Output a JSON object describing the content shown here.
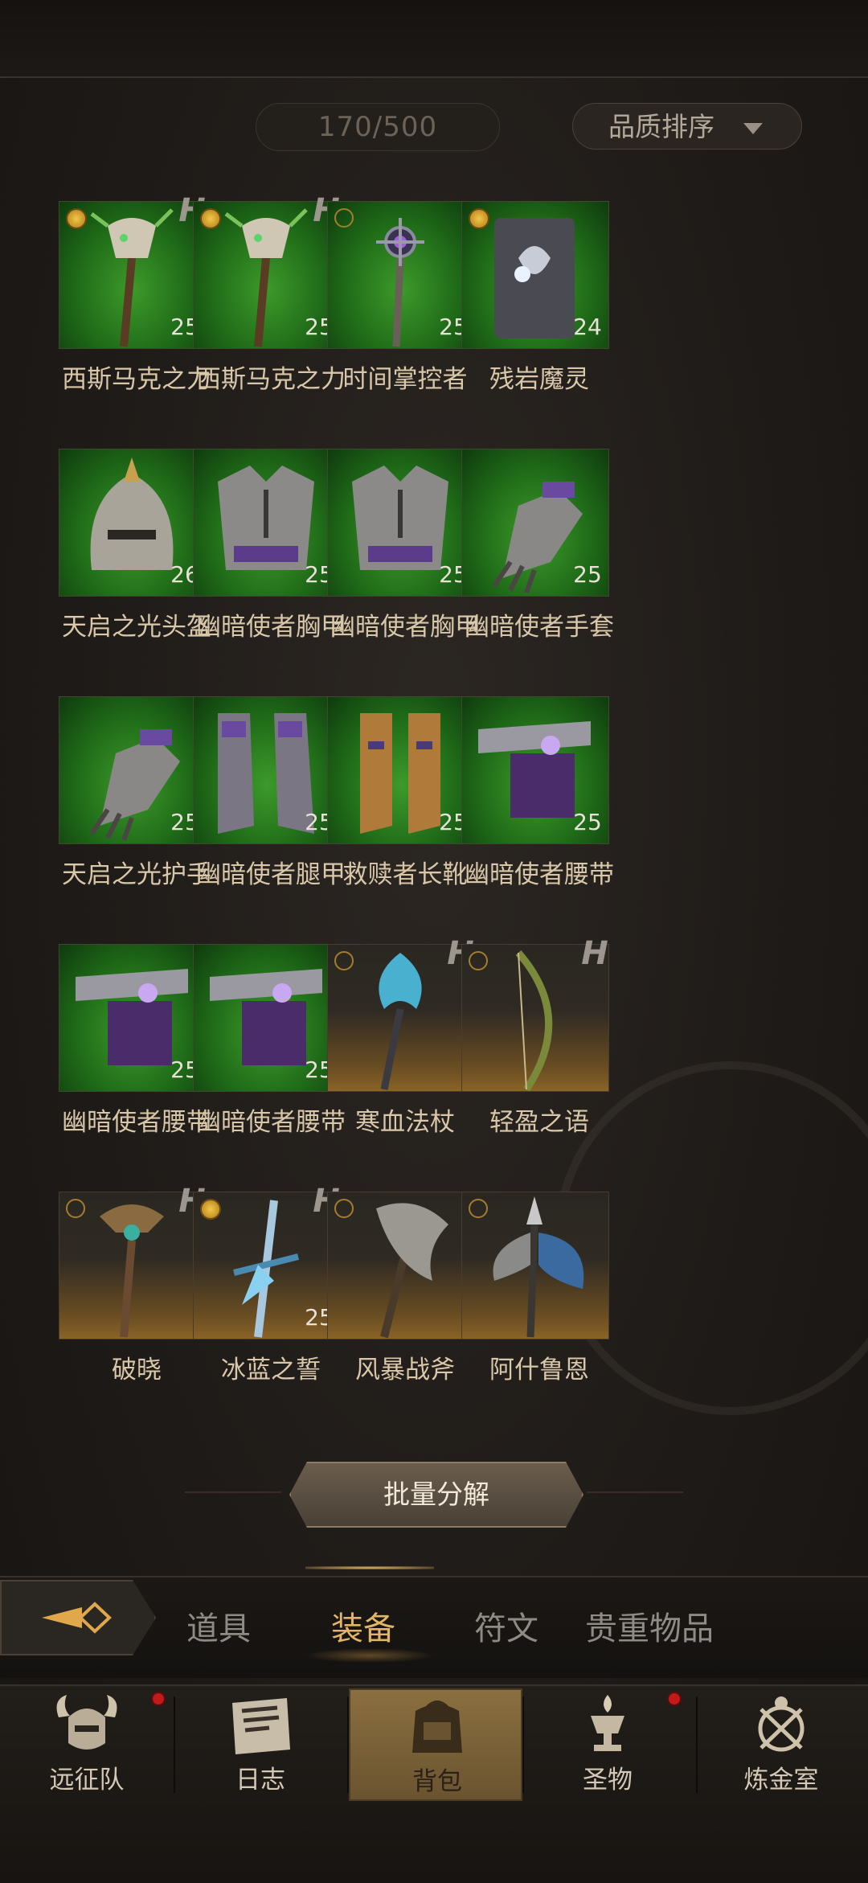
{
  "inventory": {
    "count": "170/500",
    "sort_label": "品质排序",
    "items": [
      {
        "name": "西斯马克之力",
        "level": "25",
        "bg": "green",
        "badge": "gold",
        "h": true,
        "icon": "staff-skull-icon"
      },
      {
        "name": "西斯马克之力",
        "level": "25",
        "bg": "green",
        "badge": "gold",
        "h": true,
        "icon": "staff-skull-icon"
      },
      {
        "name": "时间掌控者",
        "level": "25",
        "bg": "green",
        "badge": "ring",
        "h": false,
        "icon": "scepter-icon"
      },
      {
        "name": "残岩魔灵",
        "level": "24",
        "bg": "green",
        "badge": "gold",
        "h": false,
        "icon": "tome-icon"
      },
      {
        "name": "天启之光头盔",
        "level": "26",
        "bg": "green",
        "badge": "",
        "h": false,
        "icon": "helmet-icon"
      },
      {
        "name": "幽暗使者胸甲",
        "level": "25",
        "bg": "green",
        "badge": "",
        "h": false,
        "icon": "chest-armor-icon"
      },
      {
        "name": "幽暗使者胸甲",
        "level": "25",
        "bg": "green",
        "badge": "",
        "h": false,
        "icon": "chest-armor-icon"
      },
      {
        "name": "幽暗使者手套",
        "level": "25",
        "bg": "green",
        "badge": "",
        "h": false,
        "icon": "gauntlet-icon"
      },
      {
        "name": "天启之光护手",
        "level": "25",
        "bg": "green",
        "badge": "",
        "h": false,
        "icon": "gauntlet-icon"
      },
      {
        "name": "幽暗使者腿甲",
        "level": "25",
        "bg": "green",
        "badge": "",
        "h": false,
        "icon": "leg-armor-icon"
      },
      {
        "name": "救赎者长靴",
        "level": "25",
        "bg": "green",
        "badge": "",
        "h": false,
        "icon": "boots-icon"
      },
      {
        "name": "幽暗使者腰带",
        "level": "25",
        "bg": "green",
        "badge": "",
        "h": false,
        "icon": "belt-icon"
      },
      {
        "name": "幽暗使者腰带",
        "level": "25",
        "bg": "green",
        "badge": "",
        "h": false,
        "icon": "belt-icon"
      },
      {
        "name": "幽暗使者腰带",
        "level": "25",
        "bg": "green",
        "badge": "",
        "h": false,
        "icon": "belt-icon"
      },
      {
        "name": "寒血法杖",
        "level": "",
        "bg": "brown",
        "badge": "ring",
        "h": true,
        "icon": "ice-staff-icon"
      },
      {
        "name": "轻盈之语",
        "level": "",
        "bg": "brown",
        "badge": "ring",
        "h": true,
        "icon": "bow-icon"
      },
      {
        "name": "破晓",
        "level": "",
        "bg": "brown",
        "badge": "ring",
        "h": true,
        "icon": "staff-icon"
      },
      {
        "name": "冰蓝之誓",
        "level": "25",
        "bg": "brown",
        "badge": "gold",
        "h": true,
        "icon": "ice-sword-icon"
      },
      {
        "name": "风暴战斧",
        "level": "",
        "bg": "brown",
        "badge": "ring",
        "h": false,
        "icon": "axe-icon"
      },
      {
        "name": "阿什鲁恩",
        "level": "",
        "bg": "brown",
        "badge": "ring",
        "h": false,
        "icon": "halberd-icon"
      }
    ]
  },
  "bulk_button": "批量分解",
  "tabs": [
    {
      "label": "道具",
      "active": false
    },
    {
      "label": "装备",
      "active": true
    },
    {
      "label": "符文",
      "active": false
    },
    {
      "label": "贵重物品",
      "active": false
    }
  ],
  "nav": [
    {
      "label": "远征队",
      "icon": "horned-helmet-icon",
      "active": false,
      "dot": true
    },
    {
      "label": "日志",
      "icon": "scroll-icon",
      "active": false,
      "dot": false
    },
    {
      "label": "背包",
      "icon": "backpack-icon",
      "active": true,
      "dot": false
    },
    {
      "label": "圣物",
      "icon": "chalice-icon",
      "active": false,
      "dot": true
    },
    {
      "label": "炼金室",
      "icon": "alchemy-icon",
      "active": false,
      "dot": false
    }
  ]
}
